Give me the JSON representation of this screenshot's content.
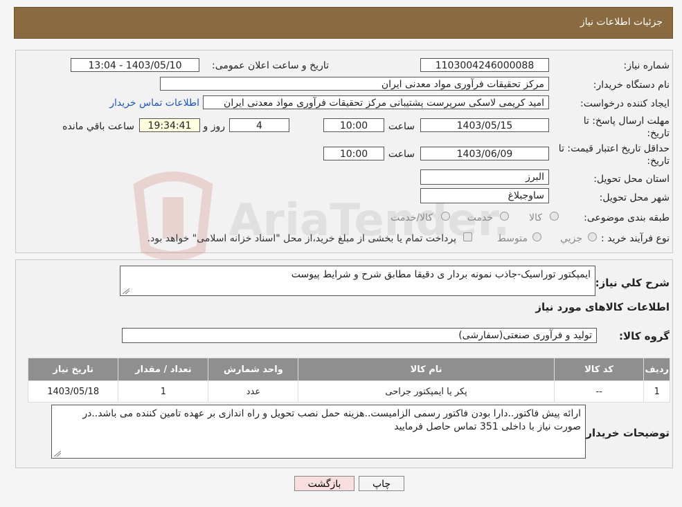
{
  "header": {
    "title": "جزئیات اطلاعات نیاز"
  },
  "fields": {
    "need_number_label": "شماره نیاز:",
    "need_number": "1103004246000088",
    "announce_label": "تاریخ و ساعت اعلان عمومی:",
    "announce_value": "1403/05/10 - 13:04",
    "buyer_org_label": "نام دستگاه خریدار:",
    "buyer_org": "مرکز تحقیقات فرآوری مواد معدنی ایران",
    "creator_label": "ایجاد کننده درخواست:",
    "creator": "امید کریمی لاسکی سرپرست پشتیبانی مرکز تحقیقات فرآوری مواد معدنی ایران",
    "contact_link": "اطلاعات تماس خریدار",
    "deadline_label": "مهلت ارسال پاسخ: تا",
    "deadline_label2": "تاریخ:",
    "deadline_date": "1403/05/15",
    "time_label": "ساعت",
    "deadline_time": "10:00",
    "days_value": "4",
    "days_label": "روز و",
    "remaining_time": "19:34:41",
    "remaining_label": "ساعت باقي مانده",
    "validity_label": "حداقل تاریخ اعتبار قیمت: تا",
    "validity_label2": "تاریخ:",
    "validity_date": "1403/06/09",
    "validity_time": "10:00",
    "province_label": "استان محل تحویل:",
    "province": "البرز",
    "city_label": "شهر محل تحویل:",
    "city": "ساوجبلاغ",
    "category_label": "طبقه بندی موضوعی:",
    "category_options": [
      "کالا",
      "خدمت",
      "کالا/خدمت"
    ],
    "process_label": "نوع فرآیند خرید :",
    "process_options": [
      "جزيي",
      "متوسط"
    ],
    "process_note": "پرداخت تمام یا بخشی از مبلغ خرید،از محل \"اسناد خزانه اسلامی\" خواهد بود."
  },
  "description": {
    "label": "شرح كلي نياز:",
    "text": "ایمپکتور توراسیک-جاذب نمونه بردار ی دقیقا مطابق شرح و شرایط پیوست"
  },
  "goods": {
    "section_title": "اطلاعات کالاهای مورد نیاز",
    "group_label": "گروه کالا:",
    "group_value": "تولید و فرآوری صنعتی(سفارشی)",
    "columns": [
      "ردیف",
      "کد کالا",
      "نام کالا",
      "واحد شمارش",
      "تعداد / مقدار",
      "تاریخ نیاز"
    ],
    "rows": [
      [
        "1",
        "--",
        "پکر یا ایمپکتور جراحی",
        "عدد",
        "1",
        "1403/05/18"
      ]
    ]
  },
  "buyer_notes": {
    "label": "توضیحات خریدار:",
    "text": "ارائه پیش فاکتور..دارا بودن فاکتور رسمی الزامیست..هزینه حمل نصب تحویل و راه اندازی بر عهده تامین کننده می باشد..در صورت نیاز با داخلی 351 تماس حاصل فرمایید"
  },
  "buttons": {
    "print": "چاپ",
    "back": "بازگشت"
  },
  "watermark": {
    "text": "AriaTender.neT"
  },
  "colors": {
    "header": "#8a6a3f",
    "link": "#1b55c7",
    "back_button": "#f8dede",
    "highlight": "#ffffe0"
  }
}
